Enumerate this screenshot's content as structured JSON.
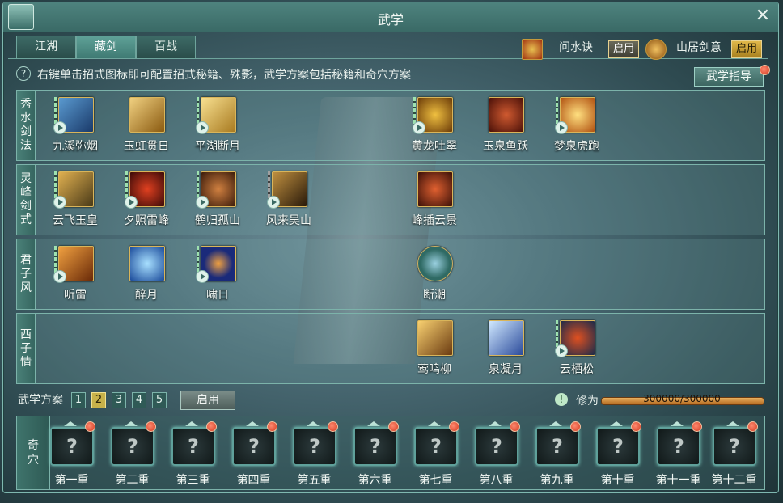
{
  "window": {
    "title": "武学",
    "close_label": "✕"
  },
  "tabs": [
    {
      "label": "江湖",
      "active": false
    },
    {
      "label": "藏剑",
      "active": true
    },
    {
      "label": "百战",
      "active": false
    }
  ],
  "stances": [
    {
      "name": "问水诀",
      "button": "启用",
      "button_style": "dark"
    },
    {
      "name": "山居剑意",
      "button": "启用",
      "button_style": "gold"
    }
  ],
  "hint": {
    "icon": "?",
    "text": "右键单击招式图标即可配置招式秘籍、殊影，武学方案包括秘籍和奇穴方案"
  },
  "guide_button": "武学指导",
  "rows": [
    {
      "label": [
        "秀",
        "水",
        "剑",
        "法"
      ],
      "skills": [
        {
          "name": "九溪弥烟",
          "color": "#2e5d8a",
          "bars": true,
          "play": true
        },
        {
          "name": "玉虹贯日",
          "color": "#b8862a",
          "bars": false,
          "play": false
        },
        {
          "name": "平湖断月",
          "color": "#c9a040",
          "bars": true,
          "play": true
        },
        {
          "name": "黄龙吐翠",
          "color": "#c58a20",
          "bars": true,
          "play": true
        },
        {
          "name": "玉泉鱼跃",
          "color": "#8a3020",
          "bars": false,
          "play": false
        },
        {
          "name": "梦泉虎跑",
          "color": "#d08a30",
          "bars": true,
          "play": true
        }
      ]
    },
    {
      "label": [
        "灵",
        "峰",
        "剑",
        "式"
      ],
      "skills": [
        {
          "name": "云飞玉皇",
          "color": "#a88030",
          "bars": true,
          "play": true
        },
        {
          "name": "夕照雷峰",
          "color": "#8a2820",
          "bars": true,
          "play": true
        },
        {
          "name": "鹤归孤山",
          "color": "#7a3a20",
          "bars": true,
          "play": true
        },
        {
          "name": "风来吴山",
          "color": "#6a4a28",
          "bars": true,
          "play": true
        },
        {
          "name": "峰插云景",
          "color": "#a04020",
          "bars": false,
          "play": false
        }
      ]
    },
    {
      "label": [
        "君",
        "子",
        "风"
      ],
      "skills": [
        {
          "name": "听雷",
          "color": "#c87a20",
          "bars": true,
          "play": true
        },
        {
          "name": "醉月",
          "color": "#2a6ab0",
          "bars": false,
          "play": false
        },
        {
          "name": "啸日",
          "color": "#2a4a9a",
          "bars": true,
          "play": true
        },
        {
          "name": "断潮",
          "color": "#3f8a80",
          "bars": false,
          "play": false
        }
      ]
    },
    {
      "label": [
        "西",
        "子",
        "情"
      ],
      "skills": [
        {
          "name": "莺鸣柳",
          "color": "#b07020",
          "bars": false,
          "play": false
        },
        {
          "name": "泉凝月",
          "color": "#3a6ab0",
          "bars": false,
          "play": false
        },
        {
          "name": "云栖松",
          "color": "#a03018",
          "bars": true,
          "play": true
        }
      ]
    }
  ],
  "plan": {
    "label": "武学方案",
    "numbers": [
      "1",
      "2",
      "3",
      "4",
      "5"
    ],
    "selected": "2",
    "apply": "启用"
  },
  "cultivation": {
    "label": "修为",
    "value": "300000/300000",
    "fill": 1.0
  },
  "qixue": {
    "label": [
      "奇",
      "穴"
    ],
    "slot_glyph": "?",
    "nodes": [
      "第一重",
      "第二重",
      "第三重",
      "第四重",
      "第五重",
      "第六重",
      "第七重",
      "第八重",
      "第九重",
      "第十重",
      "第十一重",
      "第十二重"
    ]
  }
}
